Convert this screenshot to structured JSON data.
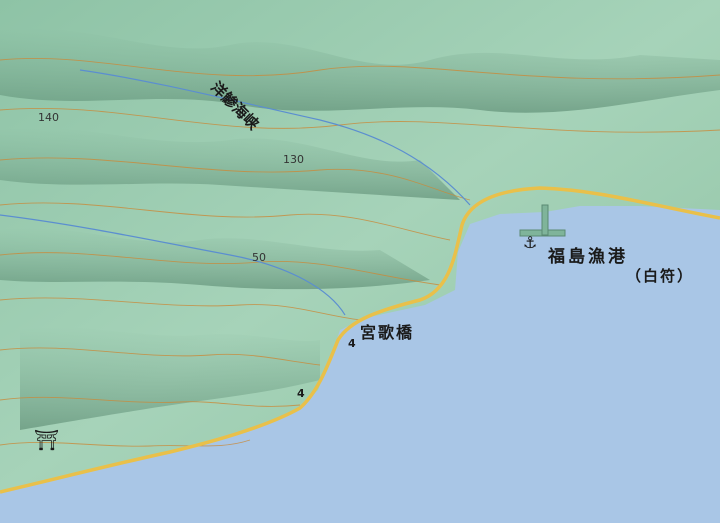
{
  "map": {
    "labels": {
      "port_name": "福島漁港",
      "port_alias": "（白符）",
      "bridge": "宮歌橋",
      "pass_line": "洋鯵海峡",
      "elev_130": "130",
      "elev_50": "50",
      "elev_140": "140",
      "route_4a": "4",
      "route_4b": "4"
    },
    "colors": {
      "sea": "#a9c6e6",
      "land": "#9fcdb3",
      "contour": "#c98a3a",
      "road": "#e9c04a",
      "river": "#5b8ed0"
    },
    "icons": [
      "anchor-icon",
      "shrine-icon"
    ]
  }
}
